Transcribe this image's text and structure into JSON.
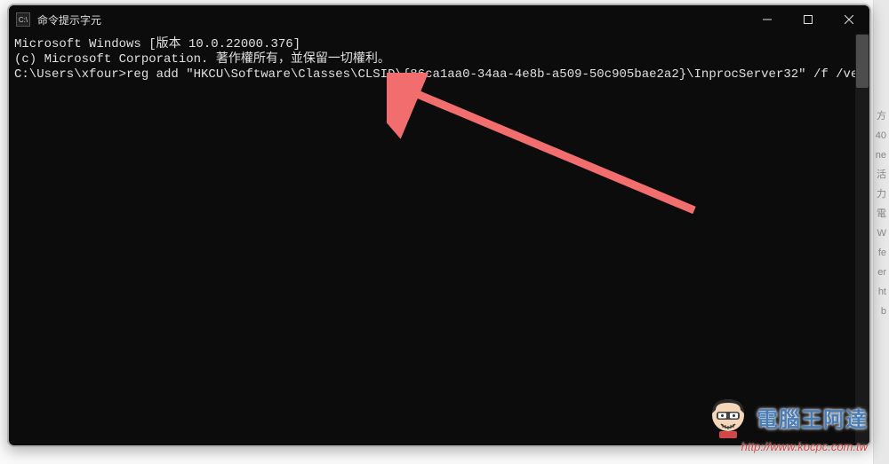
{
  "window": {
    "icon_text": "C:\\",
    "title": "命令提示字元"
  },
  "terminal": {
    "lines": [
      "Microsoft Windows [版本 10.0.22000.376]",
      "(c) Microsoft Corporation. 著作權所有，並保留一切權利。",
      "",
      "C:\\Users\\xfour>reg add \"HKCU\\Software\\Classes\\CLSID\\{86ca1aa0-34aa-4e8b-a509-50c905bae2a2}\\InprocServer32\" /f /ve"
    ]
  },
  "watermark": {
    "brand": "電腦王阿達",
    "url": "http://www.kocpc.com.tw"
  }
}
